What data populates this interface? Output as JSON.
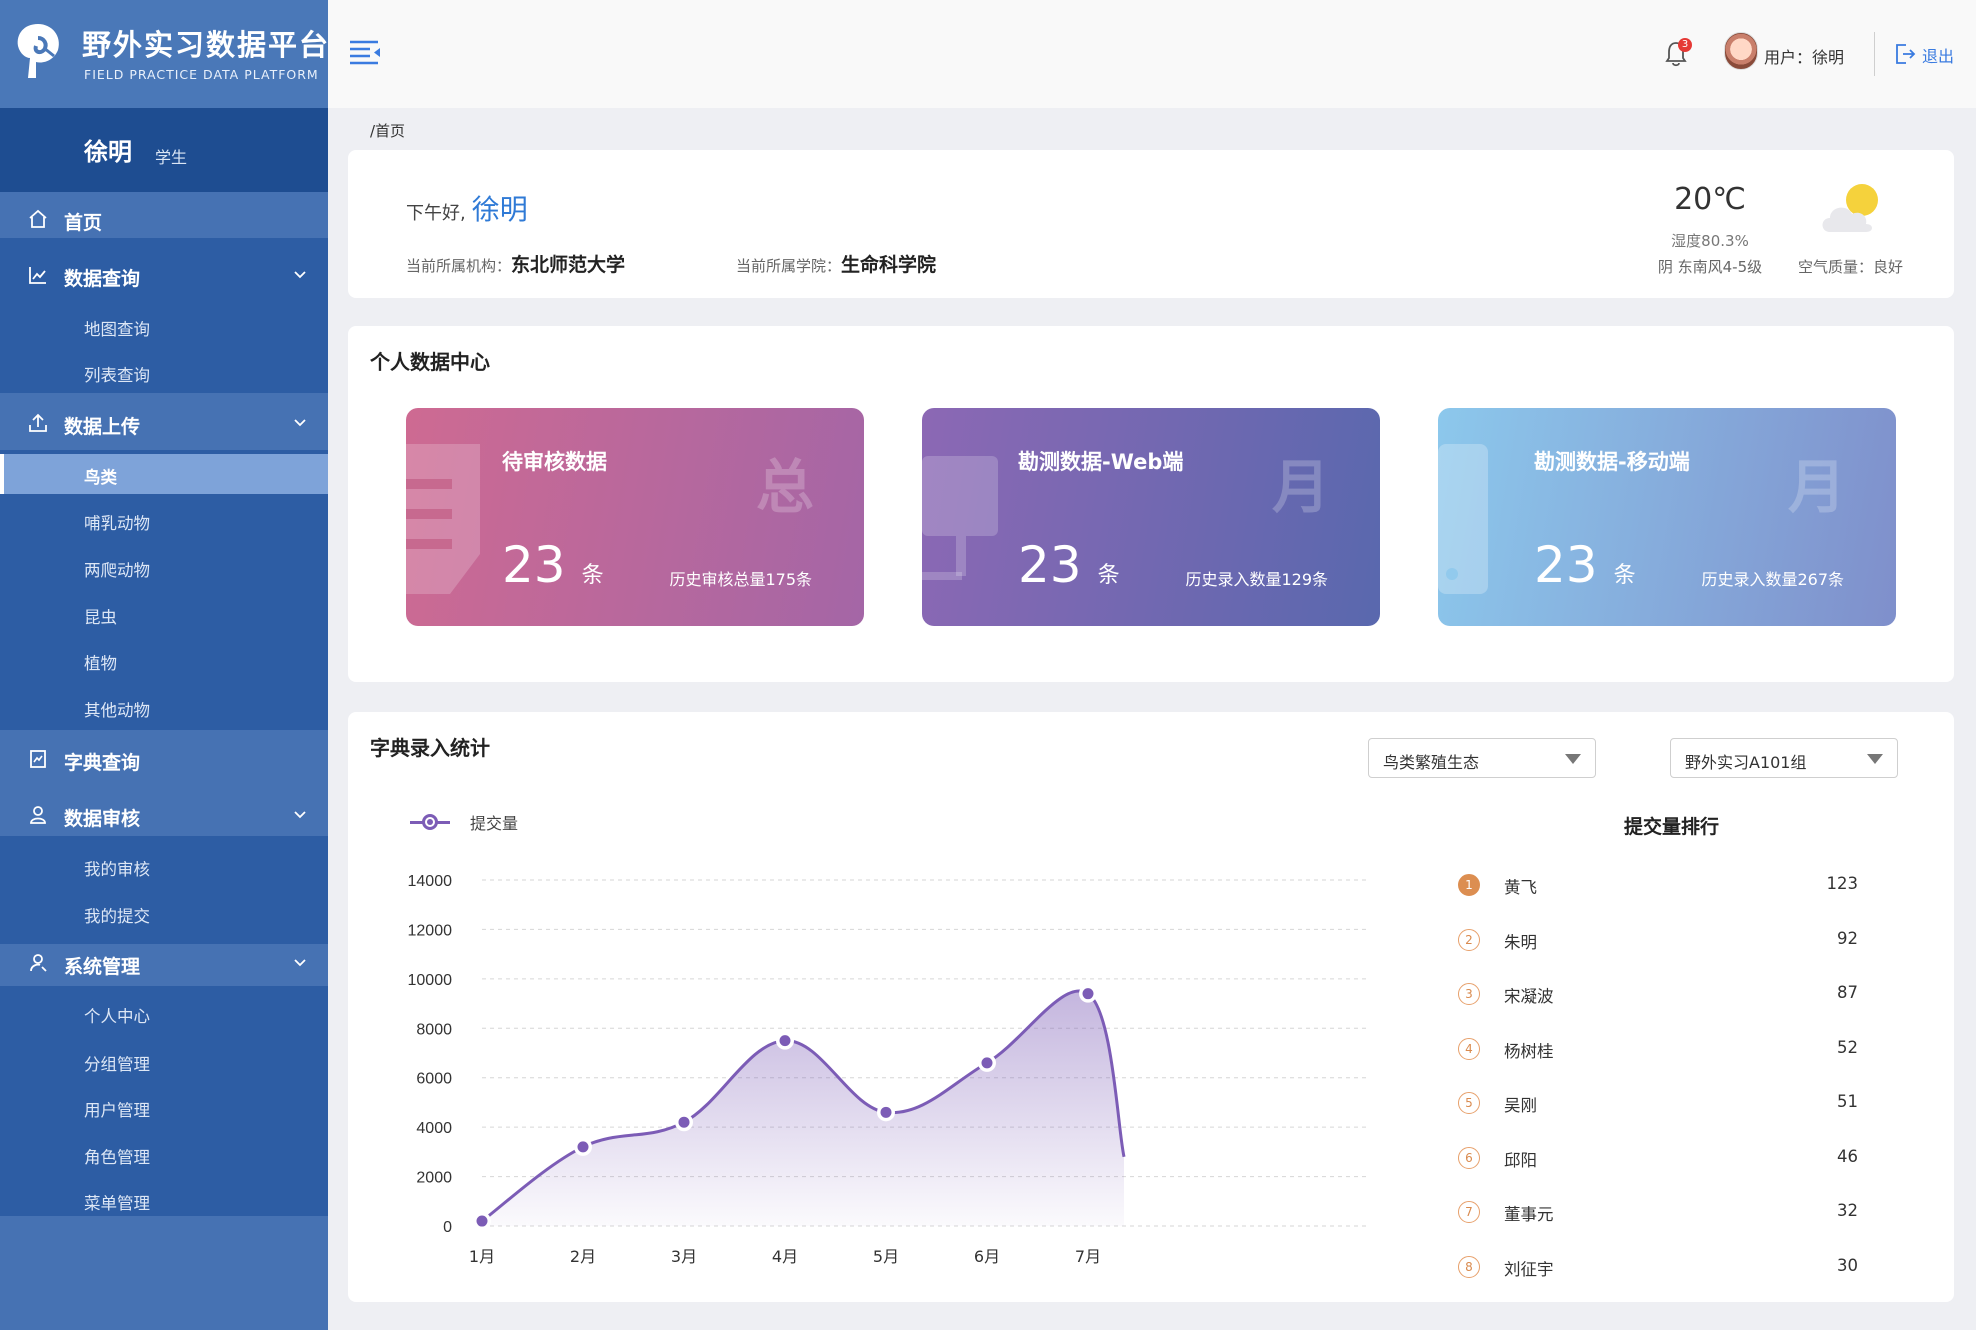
{
  "app": {
    "title": "野外实习数据平台",
    "subtitle": "FIELD PRACTICE DATA PLATFORM"
  },
  "user": {
    "name": "徐明",
    "role": "学生"
  },
  "sidebar": {
    "items": [
      {
        "label": "首页",
        "icon": "home-icon"
      },
      {
        "label": "数据查询",
        "icon": "chart-icon",
        "children": [
          "地图查询",
          "列表查询"
        ]
      },
      {
        "label": "数据上传",
        "icon": "upload-icon",
        "children": [
          "鸟类",
          "哺乳动物",
          "两爬动物",
          "昆虫",
          "植物",
          "其他动物"
        ],
        "active_child": "鸟类"
      },
      {
        "label": "字典查询",
        "icon": "dictionary-icon"
      },
      {
        "label": "数据审核",
        "icon": "user-icon",
        "children": [
          "我的审核",
          "我的提交"
        ]
      },
      {
        "label": "系统管理",
        "icon": "settings-user-icon",
        "children": [
          "个人中心",
          "分组管理",
          "用户管理",
          "角色管理",
          "菜单管理"
        ]
      }
    ]
  },
  "header": {
    "notification_count": "3",
    "user_label": "用户：徐明",
    "logout": "退出"
  },
  "breadcrumb": "/首页",
  "greeting": {
    "hello": "下午好,",
    "name": "徐明",
    "org_label": "当前所属机构：",
    "org": "东北师范大学",
    "college_label": "当前所属学院：",
    "college": "生命科学院"
  },
  "weather": {
    "temp": "20℃",
    "humidity": "湿度80.3%",
    "wind": "阴  东南风4-5级",
    "air": "空气质量：良好"
  },
  "personal": {
    "title": "个人数据中心",
    "cards": [
      {
        "name": "待审核数据",
        "count": "23",
        "unit": "条",
        "history": "历史审核总量175条",
        "watermark": "总",
        "color_from": "#ce6a92",
        "color_to": "#a466a6"
      },
      {
        "name": "勘测数据-Web端",
        "count": "23",
        "unit": "条",
        "history": "历史录入数量129条",
        "watermark": "月",
        "color_from": "#8c68b4",
        "color_to": "#5968ae"
      },
      {
        "name": "勘测数据-移动端",
        "count": "23",
        "unit": "条",
        "history": "历史录入数量267条",
        "watermark": "月",
        "color_from": "#8cc8ec",
        "color_to": "#7f8fcb"
      }
    ]
  },
  "dict_stats": {
    "title": "字典录入统计",
    "select1": "鸟类繁殖生态",
    "select2": "野外实习A101组",
    "ranking_title": "提交量排行",
    "ranking": [
      {
        "rank": "1",
        "name": "黄飞",
        "value": "123"
      },
      {
        "rank": "2",
        "name": "朱明",
        "value": "92"
      },
      {
        "rank": "3",
        "name": "宋凝波",
        "value": "87"
      },
      {
        "rank": "4",
        "name": "杨树桂",
        "value": "52"
      },
      {
        "rank": "5",
        "name": "吴刚",
        "value": "51"
      },
      {
        "rank": "6",
        "name": "邱阳",
        "value": "46"
      },
      {
        "rank": "7",
        "name": "董事元",
        "value": "32"
      },
      {
        "rank": "8",
        "name": "刘征宇",
        "value": "30"
      }
    ]
  },
  "chart_data": {
    "type": "area",
    "categories": [
      "1月",
      "2月",
      "3月",
      "4月",
      "5月",
      "6月",
      "7月"
    ],
    "series": [
      {
        "name": "提交量",
        "values": [
          200,
          3200,
          4200,
          7500,
          4600,
          6600,
          9400
        ]
      }
    ],
    "ylim": [
      0,
      14000
    ],
    "yticks": [
      0,
      2000,
      4000,
      6000,
      8000,
      10000,
      12000,
      14000
    ],
    "grid": true,
    "legend": "top-left",
    "color": "#7c5cb6"
  }
}
